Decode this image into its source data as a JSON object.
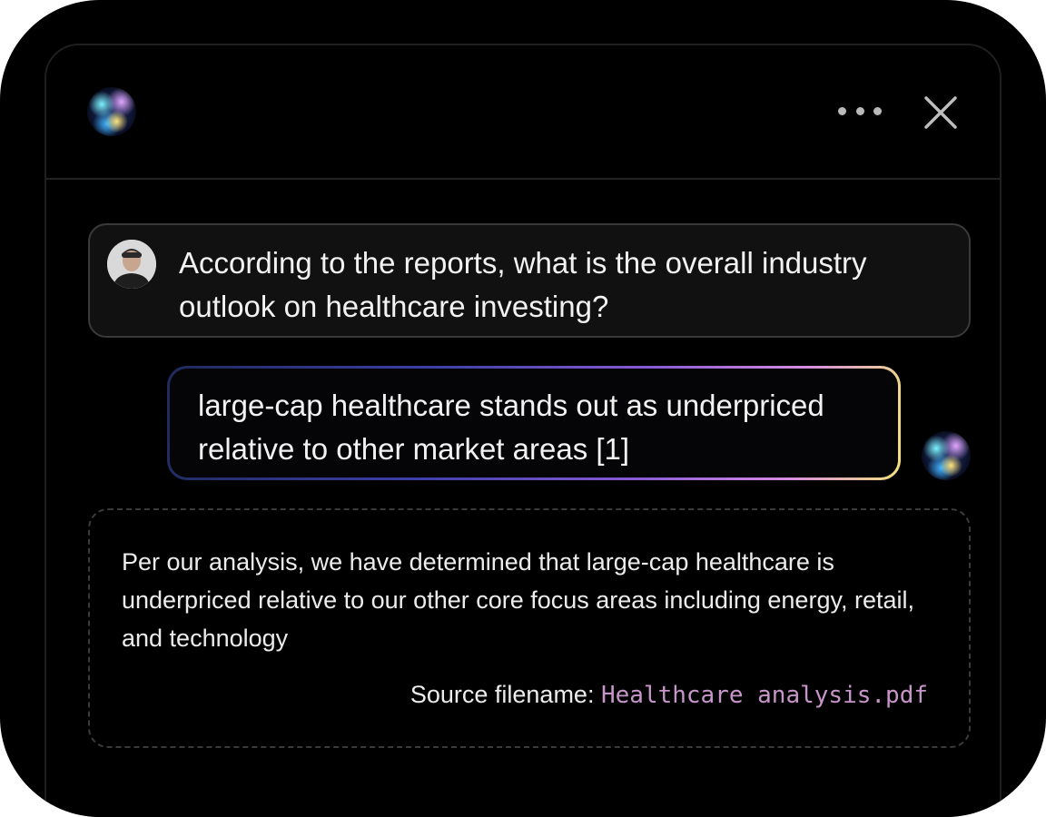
{
  "header": {
    "assistant_avatar_icon": "assistant-orb-avatar",
    "more_icon": "more-horizontal-icon",
    "close_icon": "close-icon"
  },
  "conversation": {
    "user_question": "According to the reports, what is the overall industry outlook on healthcare investing?",
    "assistant_answer": "large-cap healthcare stands out as underpriced relative to other market areas [1]"
  },
  "source": {
    "excerpt": "Per our analysis, we have determined that large-cap healthcare is underpriced relative to our other core focus areas including energy, retail, and technology",
    "label": "Source filename:",
    "filename": "Healthcare analysis.pdf"
  },
  "colors": {
    "background": "#000000",
    "border": "#3a3a3a",
    "filename_accent": "#c795c9",
    "gradient_start": "#1f2a5a",
    "gradient_mid": "#8a5bd6",
    "gradient_end": "#f3e27e"
  }
}
